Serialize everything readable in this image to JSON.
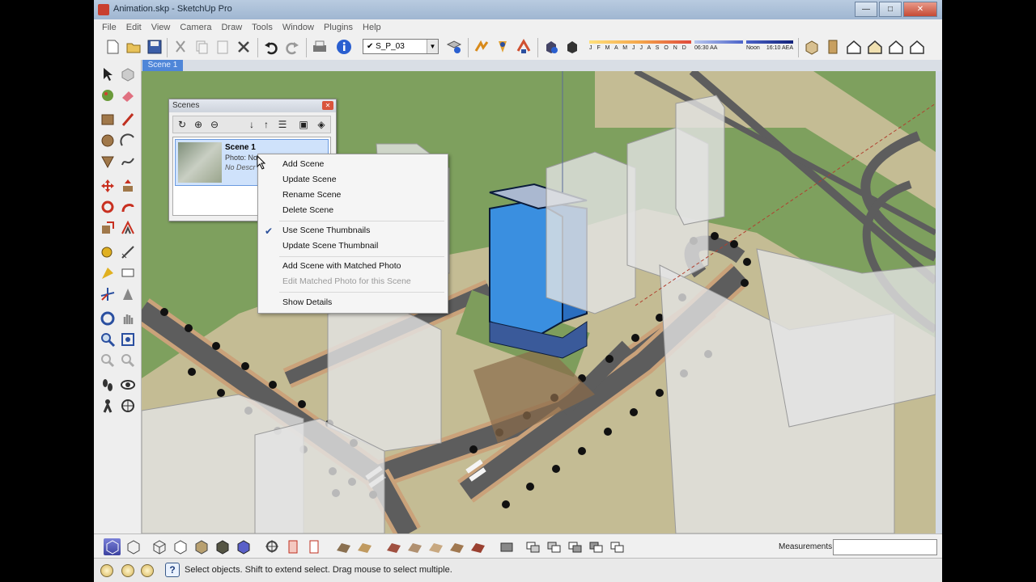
{
  "window": {
    "title": "Animation.skp - SketchUp Pro",
    "buttons": {
      "minimize": "—",
      "maximize": "□",
      "close": "✕"
    }
  },
  "menubar": {
    "items": [
      "File",
      "Edit",
      "View",
      "Camera",
      "Draw",
      "Tools",
      "Window",
      "Plugins",
      "Help"
    ]
  },
  "toolbar": {
    "scene_select_value": "S_P_03",
    "shadow_months": "J F M A M J J A S O N D",
    "time_start": "06:30 AA",
    "time_noon": "Noon",
    "time_end": "16:10 AEA"
  },
  "scene_tabs": [
    "Scene 1"
  ],
  "scenes_panel": {
    "title": "Scenes",
    "scene_name": "Scene 1",
    "scene_photo": "Photo: No",
    "scene_desc": "No Descr"
  },
  "context_menu": {
    "items": [
      {
        "label": "Add Scene",
        "enabled": true
      },
      {
        "label": "Update Scene",
        "enabled": true
      },
      {
        "label": "Rename Scene",
        "enabled": true
      },
      {
        "label": "Delete Scene",
        "enabled": true
      },
      {
        "label": "Use Scene Thumbnails",
        "enabled": true,
        "checked": true
      },
      {
        "label": "Update Scene Thumbnail",
        "enabled": true
      },
      {
        "label": "Add Scene with Matched Photo",
        "enabled": true
      },
      {
        "label": "Edit Matched Photo for this Scene",
        "enabled": false
      },
      {
        "label": "Show Details",
        "enabled": true
      }
    ]
  },
  "measurements_label": "Measurements",
  "status_text": "Select objects. Shift to extend select. Drag mouse to select multiple.",
  "colors": {
    "accent_blue": "#4f86d8",
    "grass": "#7ea05e",
    "ground": "#c4bc94",
    "road": "#5d5d5d",
    "building_glass": "#3a8fe0"
  }
}
